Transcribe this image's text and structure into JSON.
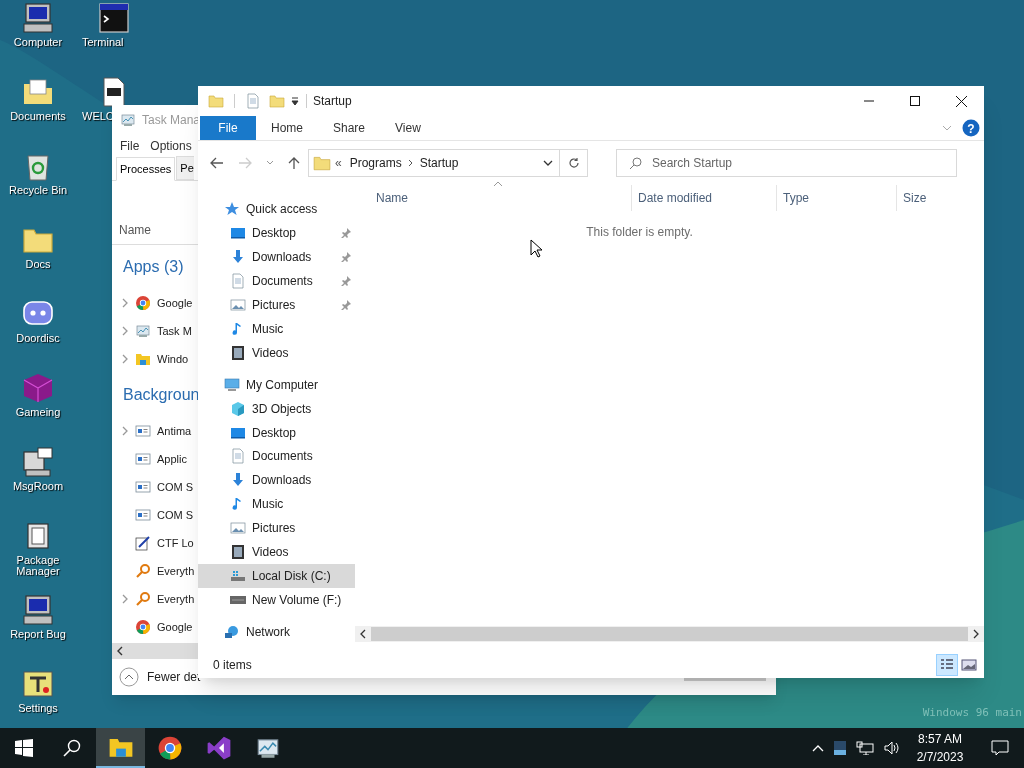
{
  "desktop": {
    "icon_columns": [
      {
        "icons": [
          {
            "label": "Computer",
            "kind": "computer"
          },
          {
            "label": "Documents",
            "kind": "docfolder"
          },
          {
            "label": "Recycle Bin",
            "kind": "bin"
          },
          {
            "label": "Docs",
            "kind": "folder"
          },
          {
            "label": "Doordisc",
            "kind": "chat"
          },
          {
            "label": "Gameing",
            "kind": "cube"
          },
          {
            "label": "MsgRoom",
            "kind": "msg"
          },
          {
            "label": "Package Manager",
            "kind": "package"
          },
          {
            "label": "Report Bug",
            "kind": "computer"
          },
          {
            "label": "Settings",
            "kind": "tools"
          }
        ]
      },
      {
        "icons": [
          {
            "label": "Terminal",
            "kind": "terminal"
          },
          {
            "label": "WELC",
            "kind": "markdown"
          }
        ]
      }
    ],
    "watermark": "Windows 96 main"
  },
  "task_manager": {
    "title": "Task Mana",
    "menu": [
      "File",
      "Options"
    ],
    "tabs": [
      {
        "label": "Processes",
        "selected": true
      },
      {
        "label": "Pe",
        "selected": false
      }
    ],
    "column": "Name",
    "groups": [
      {
        "title": "Apps (3)",
        "rows": [
          {
            "name": "Google",
            "kind": "chrome",
            "expandable": true
          },
          {
            "name": "Task M",
            "kind": "taskmgr",
            "expandable": true
          },
          {
            "name": "Windo",
            "kind": "explorer",
            "expandable": true
          }
        ]
      },
      {
        "title": "Backgroun",
        "rows": [
          {
            "name": "Antima",
            "kind": "service",
            "expandable": true
          },
          {
            "name": "Applic",
            "kind": "service",
            "expandable": false
          },
          {
            "name": "COM S",
            "kind": "service",
            "expandable": false
          },
          {
            "name": "COM S",
            "kind": "service",
            "expandable": false
          },
          {
            "name": "CTF Lo",
            "kind": "pen",
            "expandable": false
          },
          {
            "name": "Everyth",
            "kind": "search",
            "expandable": false
          },
          {
            "name": "Everyth",
            "kind": "search",
            "expandable": true
          },
          {
            "name": "Google",
            "kind": "chrome",
            "expandable": false
          }
        ]
      }
    ],
    "footer": "Fewer det"
  },
  "explorer": {
    "title": "Startup",
    "help": "?",
    "ribbon_tabs": [
      {
        "label": "File",
        "selected": true
      },
      {
        "label": "Home",
        "selected": false
      },
      {
        "label": "Share",
        "selected": false
      },
      {
        "label": "View",
        "selected": false
      }
    ],
    "breadcrumb_overflow": "«",
    "breadcrumb": [
      "Programs",
      "Startup"
    ],
    "search_placeholder": "Search Startup",
    "columns": [
      "Name",
      "Date modified",
      "Type",
      "Size"
    ],
    "empty_message": "This folder is empty.",
    "nav": [
      {
        "label": "Quick access",
        "kind": "star",
        "selected": false,
        "children": [
          {
            "label": "Desktop",
            "kind": "desktop",
            "pinned": true,
            "selected": false
          },
          {
            "label": "Downloads",
            "kind": "download",
            "pinned": true,
            "selected": false
          },
          {
            "label": "Documents",
            "kind": "document",
            "pinned": true,
            "selected": false
          },
          {
            "label": "Pictures",
            "kind": "pictures",
            "pinned": true,
            "selected": false
          },
          {
            "label": "Music",
            "kind": "music",
            "pinned": false,
            "selected": false
          },
          {
            "label": "Videos",
            "kind": "video",
            "pinned": false,
            "selected": false
          }
        ]
      },
      {
        "label": "My Computer",
        "kind": "pc",
        "selected": false,
        "children": [
          {
            "label": "3D Objects",
            "kind": "cube3d",
            "pinned": false,
            "selected": false
          },
          {
            "label": "Desktop",
            "kind": "desktop",
            "pinned": false,
            "selected": false
          },
          {
            "label": "Documents",
            "kind": "document",
            "pinned": false,
            "selected": false
          },
          {
            "label": "Downloads",
            "kind": "download",
            "pinned": false,
            "selected": false
          },
          {
            "label": "Music",
            "kind": "music",
            "pinned": false,
            "selected": false
          },
          {
            "label": "Pictures",
            "kind": "pictures",
            "pinned": false,
            "selected": false
          },
          {
            "label": "Videos",
            "kind": "video",
            "pinned": false,
            "selected": false
          },
          {
            "label": "Local Disk (C:)",
            "kind": "disk_c",
            "pinned": false,
            "selected": true
          },
          {
            "label": "New Volume (F:)",
            "kind": "disk",
            "pinned": false,
            "selected": false
          }
        ]
      },
      {
        "label": "Network",
        "kind": "network",
        "selected": false
      }
    ],
    "status": "0 items",
    "views": [
      {
        "kind": "details",
        "selected": true
      },
      {
        "kind": "tiles",
        "selected": false
      }
    ]
  },
  "taskbar": {
    "apps": [
      {
        "kind": "explorer",
        "active": true
      },
      {
        "kind": "chrome",
        "active": false
      },
      {
        "kind": "vs",
        "active": false
      },
      {
        "kind": "taskmgr",
        "active": false
      }
    ],
    "time": "8:57 AM",
    "date": "2/7/2023"
  }
}
